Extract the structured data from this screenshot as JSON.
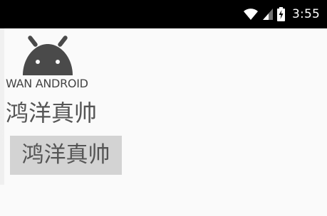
{
  "status_bar": {
    "time": "3:55",
    "background": "#000000",
    "icons": [
      "wifi-icon",
      "signal-icon",
      "battery-charging-icon"
    ]
  },
  "logo": {
    "text": "WAN ANDROID",
    "icon": "android-icon",
    "color": "#4a4a4a"
  },
  "content": {
    "text_view_label": "鸿洋真帅",
    "button_label": "鸿洋真帅",
    "button_background": "#d3d3d3"
  }
}
